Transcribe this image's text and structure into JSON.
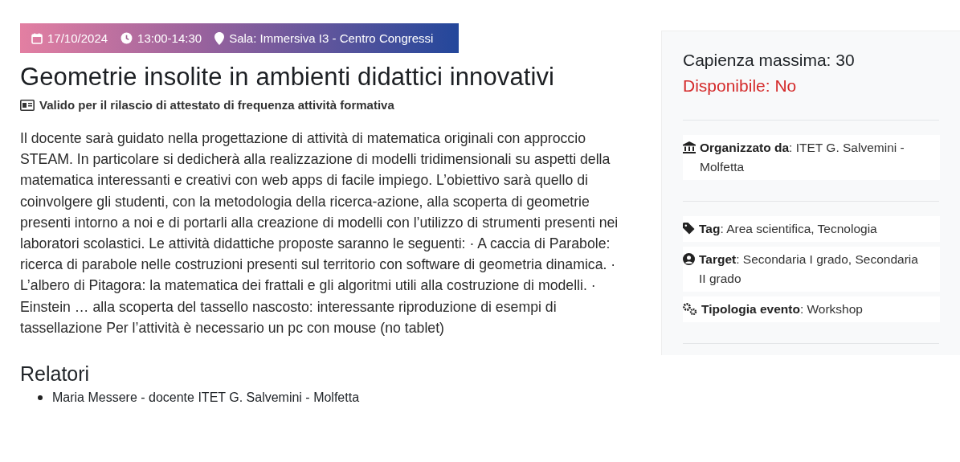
{
  "meta": [
    {
      "kind": "date",
      "text": "17/10/2024"
    },
    {
      "kind": "time",
      "text": "13:00-14:30"
    },
    {
      "kind": "place",
      "text": "Sala: Immersiva I3 - Centro Congressi"
    }
  ],
  "title": "Geometrie insolite in ambienti didattici innovativi",
  "certificate": "Valido per il rilascio di attestato di frequenza attività formativa",
  "description": "Il docente sarà guidato nella progettazione di attività di matematica originali con approccio STEAM. In particolare si dedicherà alla realizzazione di modelli tridimensionali su aspetti della matematica interessanti e creativi con web apps di facile impiego. L’obiettivo sarà quello di coinvolgere gli studenti, con la metodologia della ricerca-azione, alla scoperta di geometrie presenti intorno a noi e di portarli alla creazione di modelli con l’utilizzo di strumenti presenti nei laboratori scolastici. Le attività didattiche proposte saranno le seguenti: · A caccia di Parabole: ricerca di parabole nelle costruzioni presenti sul territorio con software di geometria dinamica. · L’albero di Pitagora: la matematica dei frattali e gli algoritmi utili alla costruzione di modelli. · Einstein … alla scoperta del tassello nascosto: interessante riproduzione di esempi di tassellazione Per l’attività è necessario un pc con mouse (no tablet)",
  "speakers": {
    "heading": "Relatori",
    "items": [
      "Maria Messere - docente ITET G. Salvemini - Molfetta"
    ]
  },
  "sidebar": {
    "capacity": "Capienza massima: 30",
    "availability": {
      "text": "Disponibile: No",
      "available": false
    },
    "groups": [
      [
        {
          "kind": "organizer",
          "text": "**Organizzato da**: ITET G. Salvemini - Molfetta"
        }
      ],
      [
        {
          "kind": "tag",
          "text": "**Tag**: Area scientifica, Tecnologia"
        },
        {
          "kind": "target",
          "text": "**Target**: Secondaria I grado, Secondaria II grado"
        },
        {
          "kind": "type",
          "text": "**Tipologia evento**: Workshop"
        }
      ]
    ]
  }
}
